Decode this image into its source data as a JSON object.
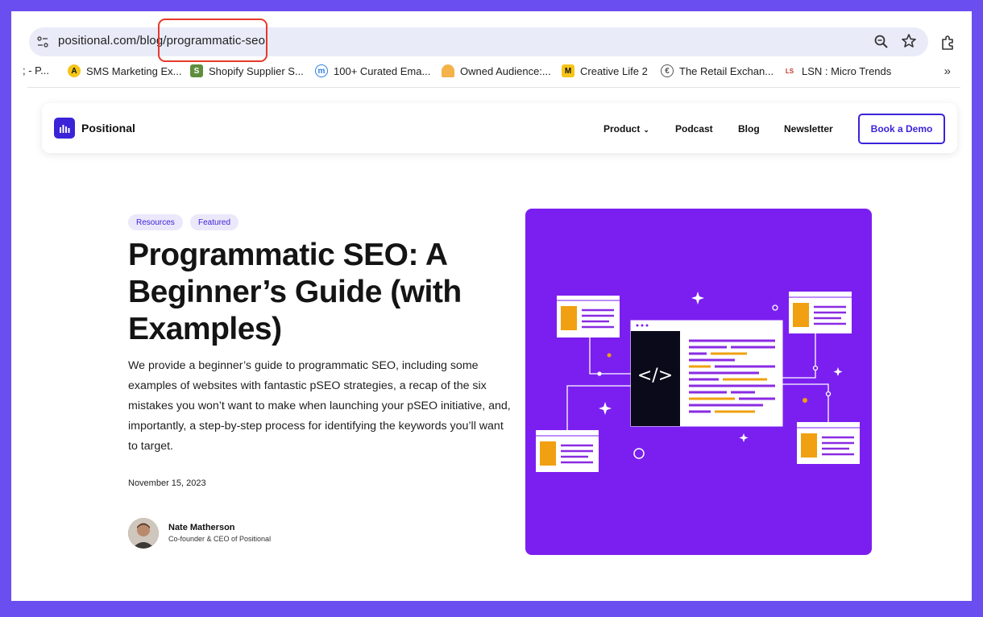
{
  "browser": {
    "url": "positional.com/blog/programmatic-seo",
    "bookmarks": [
      {
        "label": "; - P..."
      },
      {
        "label": "SMS Marketing Ex..."
      },
      {
        "label": "Shopify Supplier S..."
      },
      {
        "label": "100+ Curated Ema..."
      },
      {
        "label": "Owned Audience:..."
      },
      {
        "label": "Creative Life 2"
      },
      {
        "label": "The Retail Exchan..."
      },
      {
        "label": "LSN : Micro Trends"
      }
    ],
    "more_label": "»"
  },
  "site": {
    "logo": "Positional",
    "nav": {
      "product": "Product",
      "podcast": "Podcast",
      "blog": "Blog",
      "newsletter": "Newsletter",
      "cta": "Book a Demo"
    }
  },
  "article": {
    "tags": [
      "Resources",
      "Featured"
    ],
    "title": "Programmatic SEO: A Beginner’s Guide (with Examples)",
    "description": "We provide a beginner’s guide to programmatic SEO, including some examples of websites with fantastic pSEO strategies, a recap of the six mistakes you won’t want to make when launching your pSEO initiative, and, importantly, a step-by-step process for identifying the keywords you’ll want to target.",
    "date": "November 15, 2023",
    "author_name": "Nate Matherson",
    "author_role": "Co-founder & CEO of Positional",
    "hero_code_glyph": "</>"
  },
  "colors": {
    "frame": "#6b4ef0",
    "brand": "#3b23d8",
    "hero_bg": "#7b1ff0",
    "accent_orange": "#f0a010",
    "highlight": "#e5392b"
  }
}
